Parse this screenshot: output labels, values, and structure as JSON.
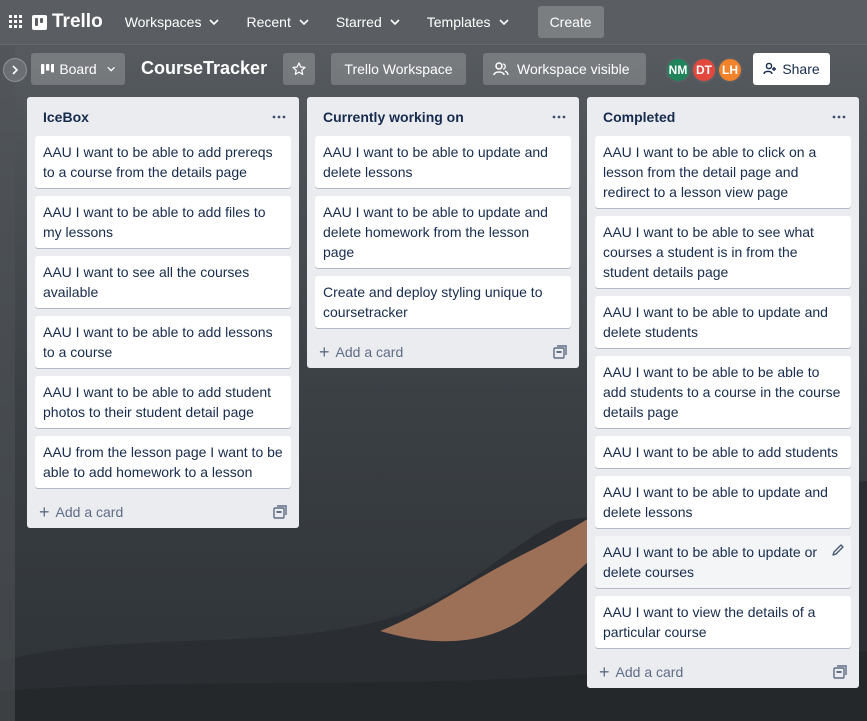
{
  "nav": {
    "app_name": "Trello",
    "items": [
      "Workspaces",
      "Recent",
      "Starred",
      "Templates"
    ],
    "create_label": "Create"
  },
  "board": {
    "view_label": "Board",
    "title": "CourseTracker",
    "workspace_label": "Trello Workspace",
    "visibility_label": "Workspace visible",
    "members": [
      {
        "initials": "NM",
        "color": "#1f845a"
      },
      {
        "initials": "DT",
        "color": "#e2483d"
      },
      {
        "initials": "LH",
        "color": "#f2832b"
      }
    ],
    "share_label": "Share"
  },
  "lists": [
    {
      "title": "IceBox",
      "cards": [
        "AAU I want to be able to add prereqs to a course from the details page",
        "AAU I want to be able to add files to my lessons",
        "AAU I want to see all the courses available",
        "AAU I want to be able to add lessons to a course",
        "AAU I want to be able to add student photos to their student detail page",
        "AAU from the lesson page I want to be able to add homework to a lesson"
      ],
      "add_label": "Add a card"
    },
    {
      "title": "Currently working on",
      "cards": [
        "AAU I want to be able to update and delete lessons",
        "AAU I want to be able to update and delete homework from the lesson page",
        "Create and deploy styling unique to coursetracker"
      ],
      "add_label": "Add a card"
    },
    {
      "title": "Completed",
      "cards": [
        "AAU I want to be able to click on a lesson from the detail page and redirect to a lesson view page",
        "AAU I want to be able to see what courses a student is in from the student details page",
        "AAU I want to be able to update and delete students",
        "AAU I want to be able to be able to add students to a course in the course details page",
        "AAU I want to be able to add students",
        "AAU I want to be able to update and delete lessons",
        "AAU I want to be able to update or delete courses",
        "AAU I want to view the details of a particular course"
      ],
      "add_label": "Add a card"
    }
  ]
}
